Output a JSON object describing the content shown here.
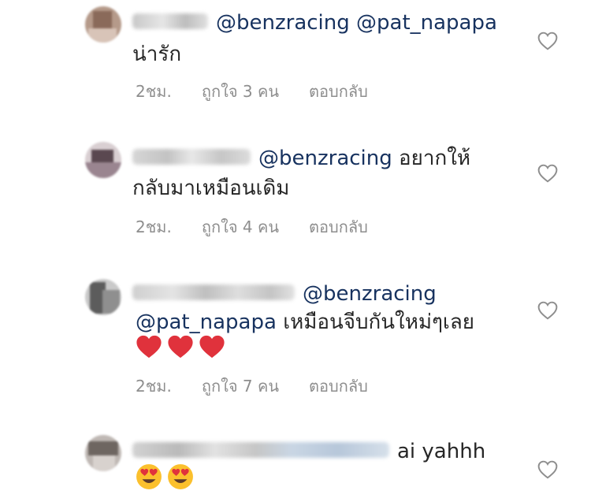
{
  "comments": [
    {
      "mentions": [
        "@benzracing",
        "@pat_napapa"
      ],
      "line1_text": "",
      "line2": "น่ารัก",
      "time": "2ชม.",
      "likes": "ถูกใจ 3 คน",
      "reply": "ตอบกลับ"
    },
    {
      "mentions": [
        "@benzracing"
      ],
      "line1_text": "อยากให้",
      "line2": "กลับมาเหมือนเดิม",
      "time": "2ชม.",
      "likes": "ถูกใจ 4 คน",
      "reply": "ตอบกลับ"
    },
    {
      "mentions": [
        "@benzracing",
        "@pat_napapa"
      ],
      "line2_text": "เหมือนจีบกันใหม่ๆเลย",
      "time": "2ชม.",
      "likes": "ถูกใจ 7 คน",
      "reply": "ตอบกลับ"
    },
    {
      "line1_text": "ai yahhh",
      "line2_emojis": [
        "heart-eyes-emoji",
        "heart-eyes-emoji"
      ]
    }
  ],
  "icons": {
    "like": "heart-outline-icon",
    "red_heart": "red-heart-emoji",
    "heart_eyes": "heart-eyes-emoji"
  },
  "colors": {
    "mention": "#17325f",
    "meta": "#8e8e8e",
    "text": "#262626",
    "heart_outline": "#8e8e8e",
    "red_heart": "#e0323c",
    "emoji_face": "#fbc02d"
  }
}
